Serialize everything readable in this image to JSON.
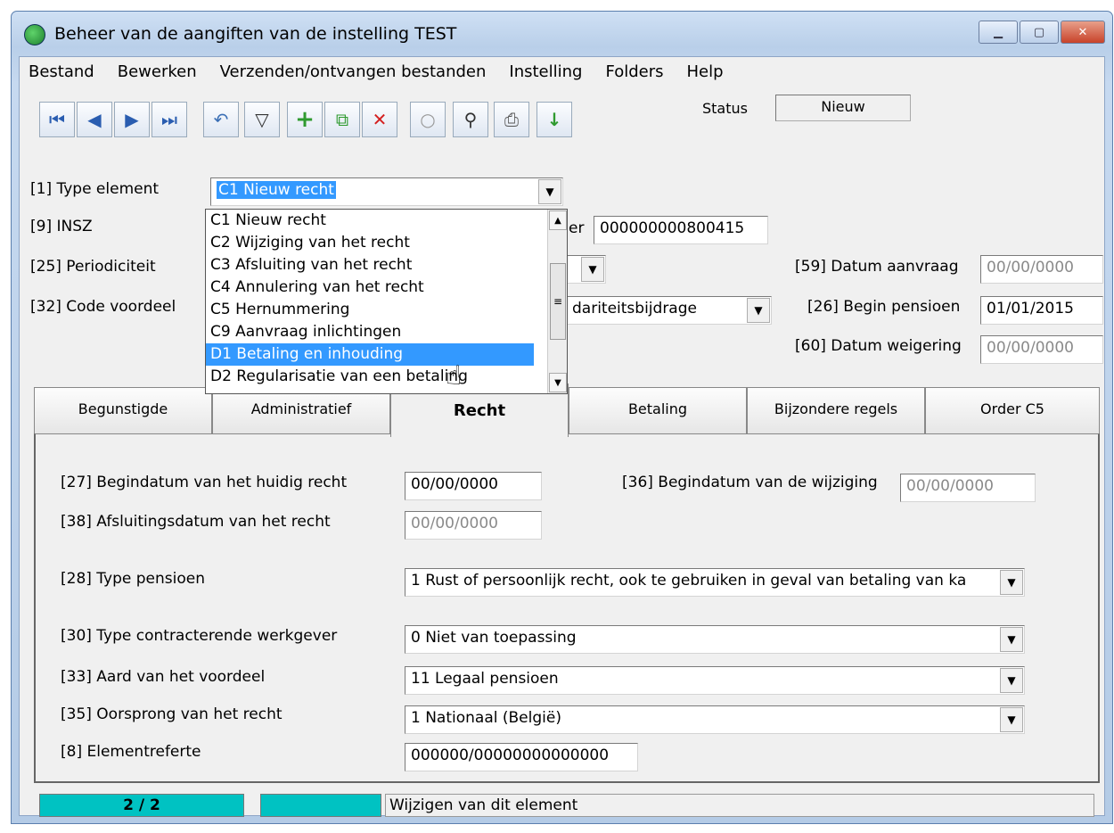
{
  "window": {
    "title": "Beheer van de aangiften van de instelling TEST"
  },
  "menu": [
    "Bestand",
    "Bewerken",
    "Verzenden/ontvangen bestanden",
    "Instelling",
    "Folders",
    "Help"
  ],
  "toolbar": {
    "icons": [
      "first-record-icon",
      "previous-record-icon",
      "next-record-icon",
      "last-record-icon",
      "undo-icon",
      "filter-icon",
      "add-icon",
      "copy-icon",
      "delete-icon",
      "circle-icon",
      "binoculars-icon",
      "print-icon",
      "download-icon"
    ],
    "status_label": "Status",
    "status_value": "Nieuw"
  },
  "header": {
    "type_element_label": "[1] Type element",
    "type_element_value": "C1 Nieuw recht",
    "insz_label": "[9] INSZ",
    "ref_label_partial": "er",
    "ref_value": "000000000800415",
    "periodiciteit_label": "[25] Periodiciteit",
    "code_voordeel_label": "[32] Code voordeel",
    "code_voordeel_partial": "dariteitsbijdrage",
    "datum_aanvraag_label": "[59] Datum aanvraag",
    "datum_aanvraag_value": "00/00/0000",
    "begin_pensioen_label": "[26] Begin pensioen",
    "begin_pensioen_value": "01/01/2015",
    "datum_weigering_label": "[60] Datum weigering",
    "datum_weigering_value": "00/00/0000"
  },
  "dropdown": {
    "items": [
      "C1 Nieuw recht",
      "C2 Wijziging van het recht",
      "C3 Afsluiting van het recht",
      "C4 Annulering van het recht",
      "C5 Hernummering",
      "C9 Aanvraag inlichtingen",
      "D1 Betaling en inhouding",
      "D2 Regularisatie van een betaling"
    ],
    "highlighted_index": 6
  },
  "tabs": [
    "Begunstigde",
    "Administratief",
    "Recht",
    "Betaling",
    "Bijzondere regels",
    "Order C5"
  ],
  "active_tab": "Recht",
  "recht": {
    "begindatum_label": "[27] Begindatum van het huidig recht",
    "begindatum_value": "00/00/0000",
    "wijziging_label": "[36] Begindatum van de wijziging",
    "wijziging_value": "00/00/0000",
    "afsluiting_label": "[38] Afsluitingsdatum van het recht",
    "afsluiting_value": "00/00/0000",
    "type_pensioen_label": "[28] Type pensioen",
    "type_pensioen_value": "1 Rust of persoonlijk recht, ook te gebruiken in geval van betaling van ka",
    "werkgever_label": "[30] Type contracterende werkgever",
    "werkgever_value": "0 Niet van toepassing",
    "aard_label": "[33] Aard van het voordeel",
    "aard_value": "11 Legaal pensioen",
    "oorsprong_label": "[35] Oorsprong van het recht",
    "oorsprong_value": "1 Nationaal (België)",
    "elementreferte_label": "[8] Elementreferte",
    "elementreferte_value": "000000/00000000000000"
  },
  "statusbar": {
    "record": "2 / 2",
    "message": "Wijzigen van dit element"
  },
  "colors": {
    "status_cell": "#00c2c2",
    "selection": "#3399ff"
  }
}
